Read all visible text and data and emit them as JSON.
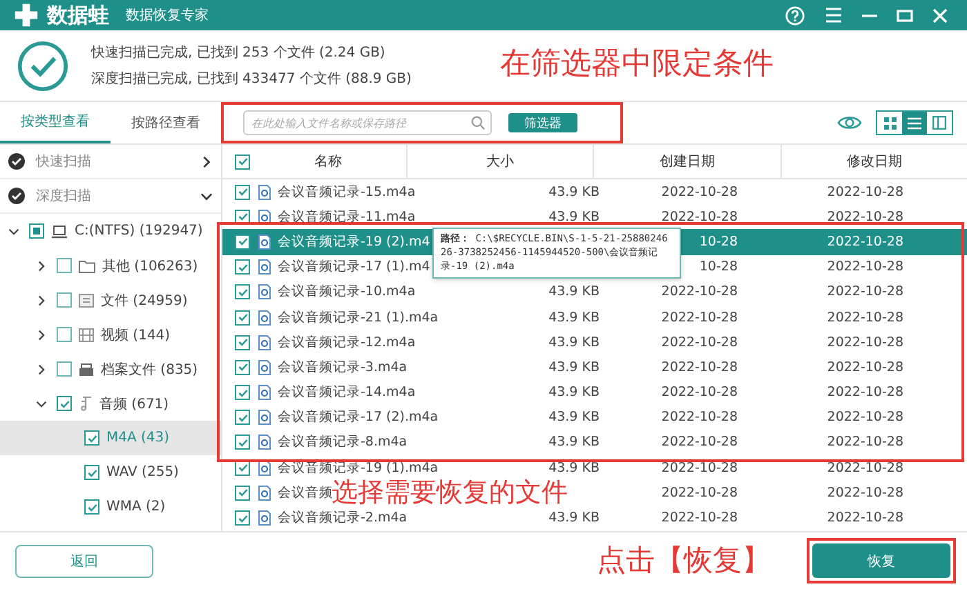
{
  "titlebar": {
    "logo_text": "数据蛙",
    "subtitle": "数据恢复专家"
  },
  "scan_summary": [
    "快速扫描已完成, 已找到 253 个文件 (2.24 GB)",
    "深度扫描已完成, 已找到 433477 个文件 (88.9 GB)"
  ],
  "view_tabs": [
    {
      "label": "按类型查看",
      "selected": true
    },
    {
      "label": "按路径查看",
      "selected": false
    }
  ],
  "search": {
    "placeholder": "在此处输入文件名称或保存路径"
  },
  "filter_button": "筛选器",
  "view_modes": [
    {
      "kind": "grid",
      "selected": false
    },
    {
      "kind": "list",
      "selected": true
    },
    {
      "kind": "detail",
      "selected": false
    }
  ],
  "scans": [
    {
      "label": "快速扫描",
      "expanded": false
    },
    {
      "label": "深度扫描",
      "expanded": true
    }
  ],
  "tree": [
    {
      "label": "C:(NTFS) (192947)",
      "kind": "drive",
      "partial": true,
      "expanded": true,
      "selected": false,
      "children": [
        {
          "label": "其他 (106263)",
          "kind": "folder",
          "checked": false,
          "expanded": false,
          "selected": false
        },
        {
          "label": "文件 (24959)",
          "kind": "document",
          "checked": false,
          "expanded": false,
          "selected": false
        },
        {
          "label": "视频 (144)",
          "kind": "video",
          "checked": false,
          "expanded": false,
          "selected": false
        },
        {
          "label": "档案文件 (835)",
          "kind": "archive",
          "checked": false,
          "expanded": false,
          "selected": false
        },
        {
          "label": "音频 (671)",
          "kind": "audio",
          "checked": true,
          "expanded": true,
          "selected": false,
          "children": [
            {
              "label": "M4A (43)",
              "checked": true,
              "selected": true
            },
            {
              "label": "WAV (255)",
              "checked": true,
              "selected": false
            },
            {
              "label": "WMA (2)",
              "checked": true,
              "selected": false
            }
          ]
        }
      ]
    }
  ],
  "table": {
    "columns": [
      "名称",
      "大小",
      "创建日期",
      "修改日期"
    ],
    "header_checked": true,
    "rows": [
      {
        "name": "会议音频记录-15.m4a",
        "size": "43.9 KB",
        "created": "2022-10-28",
        "modified": "2022-10-28",
        "checked": true,
        "selected": false
      },
      {
        "name": "会议音频记录-11.m4a",
        "size": "43.9 KB",
        "created": "2022-10-28",
        "modified": "2022-10-28",
        "checked": true,
        "selected": false
      },
      {
        "name": "会议音频记录-19 (2).m4",
        "created": "10-28",
        "modified": "2022-10-28",
        "checked": true,
        "selected": true
      },
      {
        "name": "会议音频记录-17 (1).m4",
        "created": "10-28",
        "modified": "2022-10-28",
        "checked": true,
        "selected": false
      },
      {
        "name": "会议音频记录-10.m4a",
        "size": "43.9 KB",
        "created": "2022-10-28",
        "modified": "2022-10-28",
        "checked": true,
        "selected": false
      },
      {
        "name": "会议音频记录-21 (1).m4a",
        "size": "43.9 KB",
        "created": "2022-10-28",
        "modified": "2022-10-28",
        "checked": true,
        "selected": false
      },
      {
        "name": "会议音频记录-12.m4a",
        "size": "43.9 KB",
        "created": "2022-10-28",
        "modified": "2022-10-28",
        "checked": true,
        "selected": false
      },
      {
        "name": "会议音频记录-3.m4a",
        "size": "43.9 KB",
        "created": "2022-10-28",
        "modified": "2022-10-28",
        "checked": true,
        "selected": false
      },
      {
        "name": "会议音频记录-14.m4a",
        "size": "43.9 KB",
        "created": "2022-10-28",
        "modified": "2022-10-28",
        "checked": true,
        "selected": false
      },
      {
        "name": "会议音频记录-17 (2).m4a",
        "size": "43.9 KB",
        "created": "2022-10-28",
        "modified": "2022-10-28",
        "checked": true,
        "selected": false
      },
      {
        "name": "会议音频记录-8.m4a",
        "size": "43.9 KB",
        "created": "2022-10-28",
        "modified": "2022-10-28",
        "checked": true,
        "selected": false
      },
      {
        "name": "会议音频记录-19 (1).m4a",
        "size": "43.9 KB",
        "created": "2022-10-28",
        "modified": "2022-10-28",
        "checked": true,
        "selected": false
      },
      {
        "name": "会议音频",
        "created": "2022-10-28",
        "modified": "2022-10-28",
        "checked": true,
        "selected": false
      },
      {
        "name": "会议音频记录-2.m4a",
        "size": "43.9 KB",
        "created": "2022-10-28",
        "modified": "2022-10-28",
        "checked": true,
        "selected": false
      }
    ]
  },
  "tooltip": {
    "label": "路径：",
    "path": "C:\\$RECYCLE.BIN\\S-1-5-21-2588024626-3738252456-1145944520-500\\会议音频记录-19 (2).m4a"
  },
  "back_button": "返回",
  "recover_button": "恢复",
  "annotations": [
    {
      "kind": "filter",
      "text": "在筛选器中限定条件"
    },
    {
      "kind": "select",
      "text": "选择需要恢复的文件"
    },
    {
      "kind": "recover",
      "text": "点击【恢复】"
    }
  ]
}
